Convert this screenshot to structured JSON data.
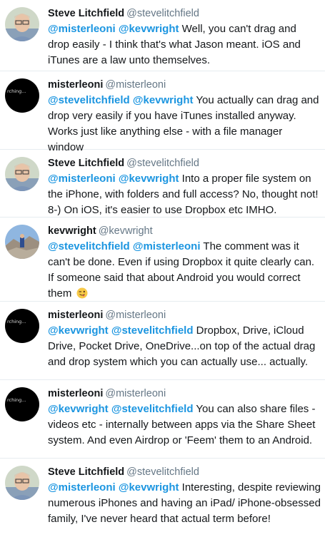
{
  "tweets": [
    {
      "name": "Steve Litchfield",
      "handle": "@stevelitchfield",
      "avatar": "steve-avatar",
      "mentions": [
        "@misterleoni",
        "@kevwright"
      ],
      "text": "Well, you can't drag and drop easily - I think that's what Jason meant. iOS and iTunes are a law unto themselves."
    },
    {
      "name": "misterleoni",
      "handle": "@misterleoni",
      "avatar": "misterleoni-avatar",
      "avatar_caption": "rching...",
      "mentions": [
        "@stevelitchfield",
        "@kevwright"
      ],
      "text": "You actually can drag and drop very easily if you have iTunes installed anyway. Works just like anything else - with a file manager window"
    },
    {
      "name": "Steve Litchfield",
      "handle": "@stevelitchfield",
      "avatar": "steve-avatar",
      "mentions": [
        "@misterleoni",
        "@kevwright"
      ],
      "text": "Into a proper file system on the iPhone, with folders and full access? No, thought not! 8-) On iOS, it's easier to use Dropbox etc IMHO."
    },
    {
      "name": "kevwright",
      "handle": "@kevwright",
      "avatar": "kevwright-avatar",
      "mentions": [
        "@stevelitchfield",
        "@misterleoni"
      ],
      "text": "The comment was it can't be done. Even if using Dropbox it quite clearly can. If someone said that about Android you would correct them",
      "emoji": "winking-tongue-emoji"
    },
    {
      "name": "misterleoni",
      "handle": "@misterleoni",
      "avatar": "misterleoni-avatar",
      "avatar_caption": "rching...",
      "mentions": [
        "@kevwright",
        "@stevelitchfield"
      ],
      "text": "Dropbox, Drive, iCloud Drive, Pocket Drive, OneDrive...on top of the actual drag and drop system which you can actually use... actually."
    },
    {
      "name": "misterleoni",
      "handle": "@misterleoni",
      "avatar": "misterleoni-avatar",
      "avatar_caption": "rching...",
      "mentions": [
        "@kevwright",
        "@stevelitchfield"
      ],
      "text": "You can also share files - videos etc - internally between apps via the Share Sheet system. And even Airdrop or 'Feem' them to an Android."
    },
    {
      "name": "Steve Litchfield",
      "handle": "@stevelitchfield",
      "avatar": "steve-avatar",
      "mentions": [
        "@misterleoni",
        "@kevwright"
      ],
      "text": "Interesting, despite reviewing numerous iPhones and having an iPad/ iPhone-obsessed family, I've never heard that actual term before!"
    }
  ],
  "colors": {
    "mention": "#1b95e0",
    "handle": "#657786",
    "divider": "#e6ecf0"
  }
}
